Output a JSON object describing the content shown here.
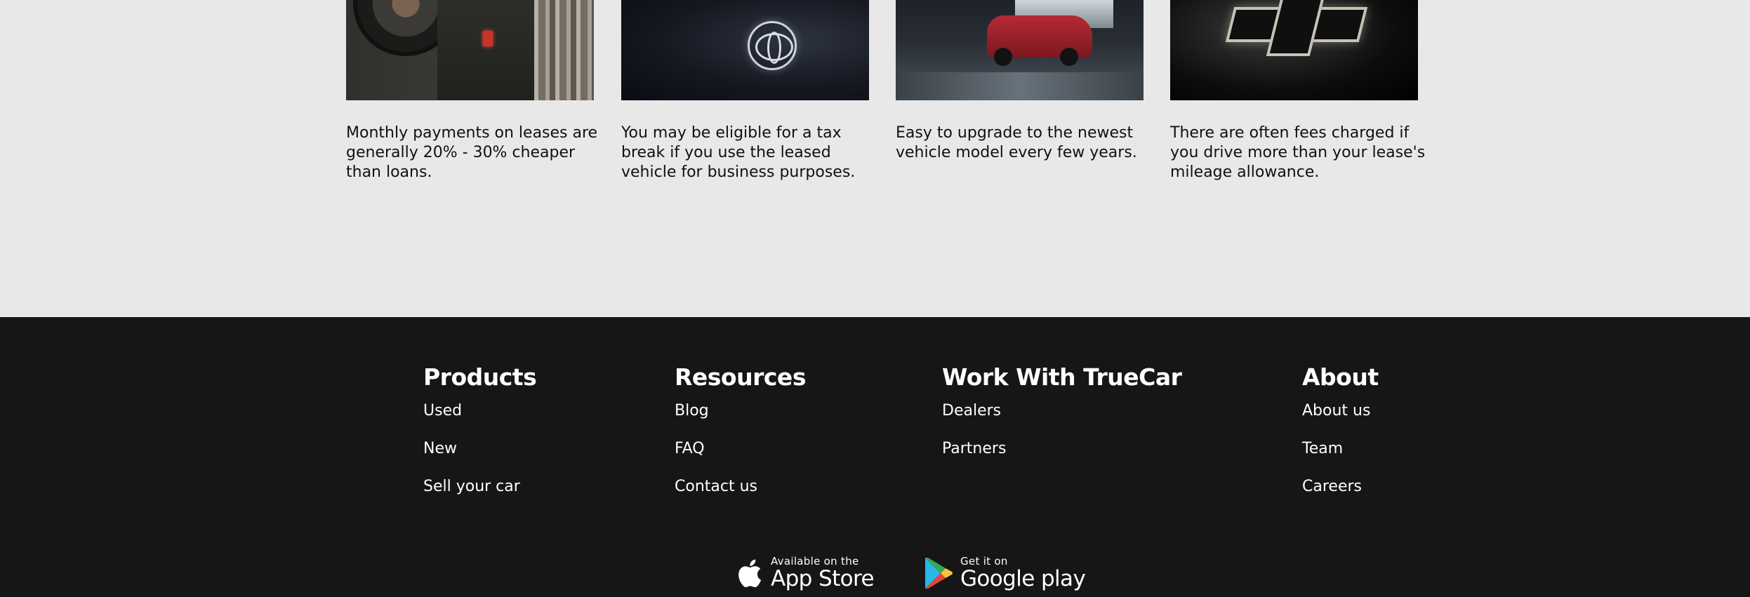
{
  "cards": [
    {
      "image": "jeep-spare-tire-photo",
      "text": "Monthly payments on leases are generally 20% - 30% cheaper than loans."
    },
    {
      "image": "toyota-steering-wheel-photo",
      "text": "You may be eligible for a tax break if you use the leased vehicle for business purposes."
    },
    {
      "image": "red-suv-photo",
      "text": "Easy to upgrade to the newest vehicle model every few years."
    },
    {
      "image": "chevrolet-logo-photo",
      "text": "There are often fees charged if you drive more than your lease's mileage allowance."
    }
  ],
  "footer": {
    "columns": [
      {
        "title": "Products",
        "links": [
          "Used",
          "New",
          "Sell your car"
        ]
      },
      {
        "title": "Resources",
        "links": [
          "Blog",
          "FAQ",
          "Contact us"
        ]
      },
      {
        "title": "Work With TrueCar",
        "links": [
          "Dealers",
          "Partners"
        ]
      },
      {
        "title": "About",
        "links": [
          "About us",
          "Team",
          "Careers"
        ]
      }
    ],
    "app_store": {
      "small": "Available on the",
      "big": "App Store",
      "icon": "apple-icon"
    },
    "google_play": {
      "small": "Get it on",
      "big": "Google play",
      "icon": "google-play-icon"
    }
  },
  "colors": {
    "page_bg": "#e8e8e8",
    "footer_bg": "#161616",
    "text_dark": "#111111",
    "text_light": "#ffffff"
  }
}
